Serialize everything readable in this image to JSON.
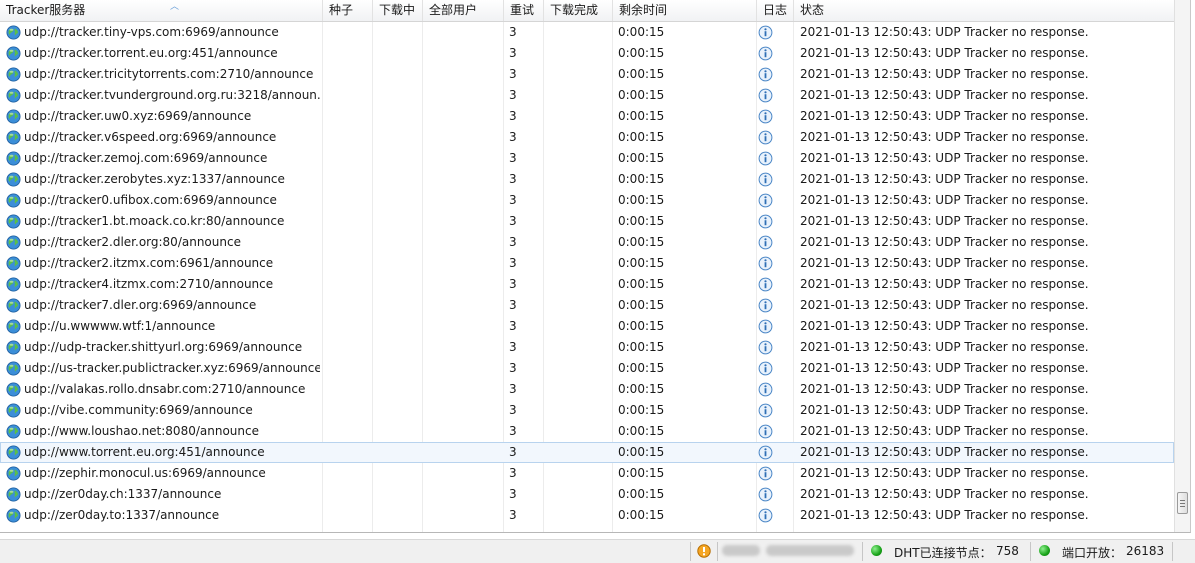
{
  "columns": {
    "tracker": "Tracker服务器",
    "seeds": "种子",
    "downloading": "下载中",
    "all_users": "全部用户",
    "retry": "重试",
    "completed": "下载完成",
    "remaining": "剩余时间",
    "log": "日志",
    "status": "状态"
  },
  "rows": [
    {
      "url": "udp://tracker.tiny-vps.com:6969/announce",
      "retry": "3",
      "remaining": "0:00:15",
      "status": "2021-01-13 12:50:43: UDP Tracker no response."
    },
    {
      "url": "udp://tracker.torrent.eu.org:451/announce",
      "retry": "3",
      "remaining": "0:00:15",
      "status": "2021-01-13 12:50:43: UDP Tracker no response."
    },
    {
      "url": "udp://tracker.tricitytorrents.com:2710/announce",
      "retry": "3",
      "remaining": "0:00:15",
      "status": "2021-01-13 12:50:43: UDP Tracker no response."
    },
    {
      "url": "udp://tracker.tvunderground.org.ru:3218/announ...",
      "retry": "3",
      "remaining": "0:00:15",
      "status": "2021-01-13 12:50:43: UDP Tracker no response."
    },
    {
      "url": "udp://tracker.uw0.xyz:6969/announce",
      "retry": "3",
      "remaining": "0:00:15",
      "status": "2021-01-13 12:50:43: UDP Tracker no response."
    },
    {
      "url": "udp://tracker.v6speed.org:6969/announce",
      "retry": "3",
      "remaining": "0:00:15",
      "status": "2021-01-13 12:50:43: UDP Tracker no response."
    },
    {
      "url": "udp://tracker.zemoj.com:6969/announce",
      "retry": "3",
      "remaining": "0:00:15",
      "status": "2021-01-13 12:50:43: UDP Tracker no response."
    },
    {
      "url": "udp://tracker.zerobytes.xyz:1337/announce",
      "retry": "3",
      "remaining": "0:00:15",
      "status": "2021-01-13 12:50:43: UDP Tracker no response."
    },
    {
      "url": "udp://tracker0.ufibox.com:6969/announce",
      "retry": "3",
      "remaining": "0:00:15",
      "status": "2021-01-13 12:50:43: UDP Tracker no response."
    },
    {
      "url": "udp://tracker1.bt.moack.co.kr:80/announce",
      "retry": "3",
      "remaining": "0:00:15",
      "status": "2021-01-13 12:50:43: UDP Tracker no response."
    },
    {
      "url": "udp://tracker2.dler.org:80/announce",
      "retry": "3",
      "remaining": "0:00:15",
      "status": "2021-01-13 12:50:43: UDP Tracker no response."
    },
    {
      "url": "udp://tracker2.itzmx.com:6961/announce",
      "retry": "3",
      "remaining": "0:00:15",
      "status": "2021-01-13 12:50:43: UDP Tracker no response."
    },
    {
      "url": "udp://tracker4.itzmx.com:2710/announce",
      "retry": "3",
      "remaining": "0:00:15",
      "status": "2021-01-13 12:50:43: UDP Tracker no response."
    },
    {
      "url": "udp://tracker7.dler.org:6969/announce",
      "retry": "3",
      "remaining": "0:00:15",
      "status": "2021-01-13 12:50:43: UDP Tracker no response."
    },
    {
      "url": "udp://u.wwwww.wtf:1/announce",
      "retry": "3",
      "remaining": "0:00:15",
      "status": "2021-01-13 12:50:43: UDP Tracker no response."
    },
    {
      "url": "udp://udp-tracker.shittyurl.org:6969/announce",
      "retry": "3",
      "remaining": "0:00:15",
      "status": "2021-01-13 12:50:43: UDP Tracker no response."
    },
    {
      "url": "udp://us-tracker.publictracker.xyz:6969/announce",
      "retry": "3",
      "remaining": "0:00:15",
      "status": "2021-01-13 12:50:43: UDP Tracker no response."
    },
    {
      "url": "udp://valakas.rollo.dnsabr.com:2710/announce",
      "retry": "3",
      "remaining": "0:00:15",
      "status": "2021-01-13 12:50:43: UDP Tracker no response."
    },
    {
      "url": "udp://vibe.community:6969/announce",
      "retry": "3",
      "remaining": "0:00:15",
      "status": "2021-01-13 12:50:43: UDP Tracker no response."
    },
    {
      "url": "udp://www.loushao.net:8080/announce",
      "retry": "3",
      "remaining": "0:00:15",
      "status": "2021-01-13 12:50:43: UDP Tracker no response."
    },
    {
      "url": "udp://www.torrent.eu.org:451/announce",
      "retry": "3",
      "remaining": "0:00:15",
      "status": "2021-01-13 12:50:43: UDP Tracker no response.",
      "selected": true
    },
    {
      "url": "udp://zephir.monocul.us:6969/announce",
      "retry": "3",
      "remaining": "0:00:15",
      "status": "2021-01-13 12:50:43: UDP Tracker no response."
    },
    {
      "url": "udp://zer0day.ch:1337/announce",
      "retry": "3",
      "remaining": "0:00:15",
      "status": "2021-01-13 12:50:43: UDP Tracker no response."
    },
    {
      "url": "udp://zer0day.to:1337/announce",
      "retry": "3",
      "remaining": "0:00:15",
      "status": "2021-01-13 12:50:43: UDP Tracker no response."
    }
  ],
  "status_bar": {
    "dht_label": "DHT已连接节点：",
    "dht_nodes": "758",
    "port_label": "端口开放：",
    "port": "26183"
  },
  "colors": {
    "selected_row_bg": "#f2f7fd",
    "online_dot": "#19a319"
  }
}
